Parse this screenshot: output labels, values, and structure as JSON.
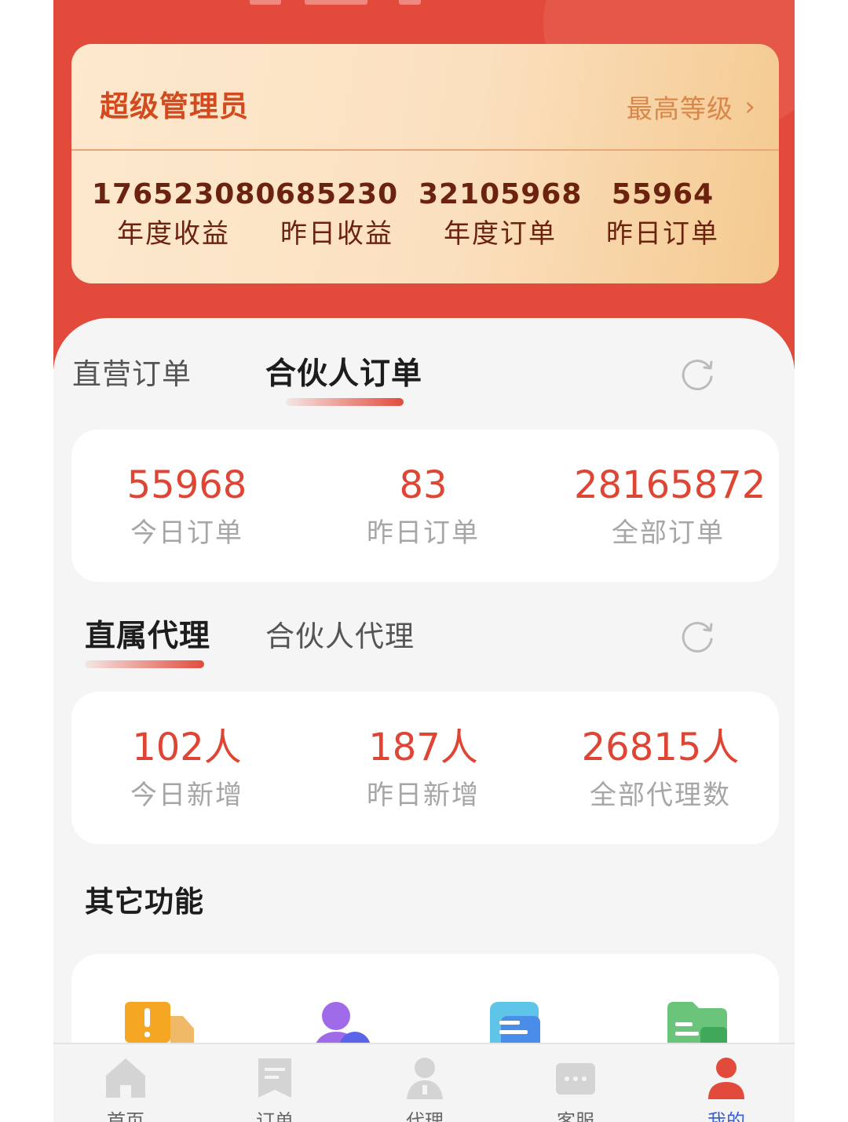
{
  "vip": {
    "role": "超级管理员",
    "level_link": "最高等级",
    "stats": [
      {
        "value": "176523080",
        "label": "年度收益"
      },
      {
        "value": "685230",
        "label": "昨日收益"
      },
      {
        "value": "32105968",
        "label": "年度订单"
      },
      {
        "value": "55964",
        "label": "昨日订单"
      }
    ]
  },
  "orders": {
    "tabs": [
      {
        "label": "直营订单",
        "active": false
      },
      {
        "label": "合伙人订单",
        "active": true
      }
    ],
    "stats": [
      {
        "value": "55968",
        "label": "今日订单"
      },
      {
        "value": "83",
        "label": "昨日订单"
      },
      {
        "value": "28165872",
        "label": "全部订单"
      }
    ]
  },
  "agents": {
    "tabs": [
      {
        "label": "直属代理",
        "active": true
      },
      {
        "label": "合伙人代理",
        "active": false
      }
    ],
    "stats": [
      {
        "value": "102人",
        "label": "今日新增"
      },
      {
        "value": "187人",
        "label": "昨日新增"
      },
      {
        "value": "26815人",
        "label": "全部代理数"
      }
    ]
  },
  "other": {
    "title": "其它功能",
    "icons": [
      "truck-alert-icon",
      "agent-support-icon",
      "document-icon",
      "folder-icon"
    ]
  },
  "tabbar": {
    "items": [
      {
        "label": "首页",
        "icon": "home-icon",
        "active": false
      },
      {
        "label": "订单",
        "icon": "order-icon",
        "active": false
      },
      {
        "label": "代理",
        "icon": "agent-icon",
        "active": false
      },
      {
        "label": "客服",
        "icon": "chat-icon",
        "active": false
      },
      {
        "label": "我的",
        "icon": "user-icon",
        "active": true
      }
    ]
  },
  "colors": {
    "brand_red": "#e24b3c",
    "stat_red": "#df4535",
    "gold_text": "#d8864a",
    "active_tab_label": "#3a5fd6"
  }
}
